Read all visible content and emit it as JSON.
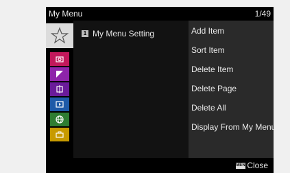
{
  "header": {
    "title": "My Menu",
    "page_indicator": "1/49"
  },
  "tabs": [
    {
      "name": "star-tab-icon",
      "color": "#dcdcdc"
    },
    {
      "name": "shooting-tab-icon",
      "color": "#c2185b"
    },
    {
      "name": "exposure-tab-icon",
      "color": "#8e24aa"
    },
    {
      "name": "focus-tab-icon",
      "color": "#6a1b9a"
    },
    {
      "name": "playback-tab-icon",
      "color": "#1e5aa8"
    },
    {
      "name": "network-tab-icon",
      "color": "#2e7d32"
    },
    {
      "name": "setup-tab-icon",
      "color": "#c79a00"
    }
  ],
  "left_panel": {
    "number_badge": "1",
    "label": "My Menu Setting"
  },
  "menu_items": [
    "Add Item",
    "Sort Item",
    "Delete Item",
    "Delete Page",
    "Delete All",
    "Display From My Menu"
  ],
  "footer": {
    "menu_key": "MENU",
    "close_label": "Close"
  }
}
